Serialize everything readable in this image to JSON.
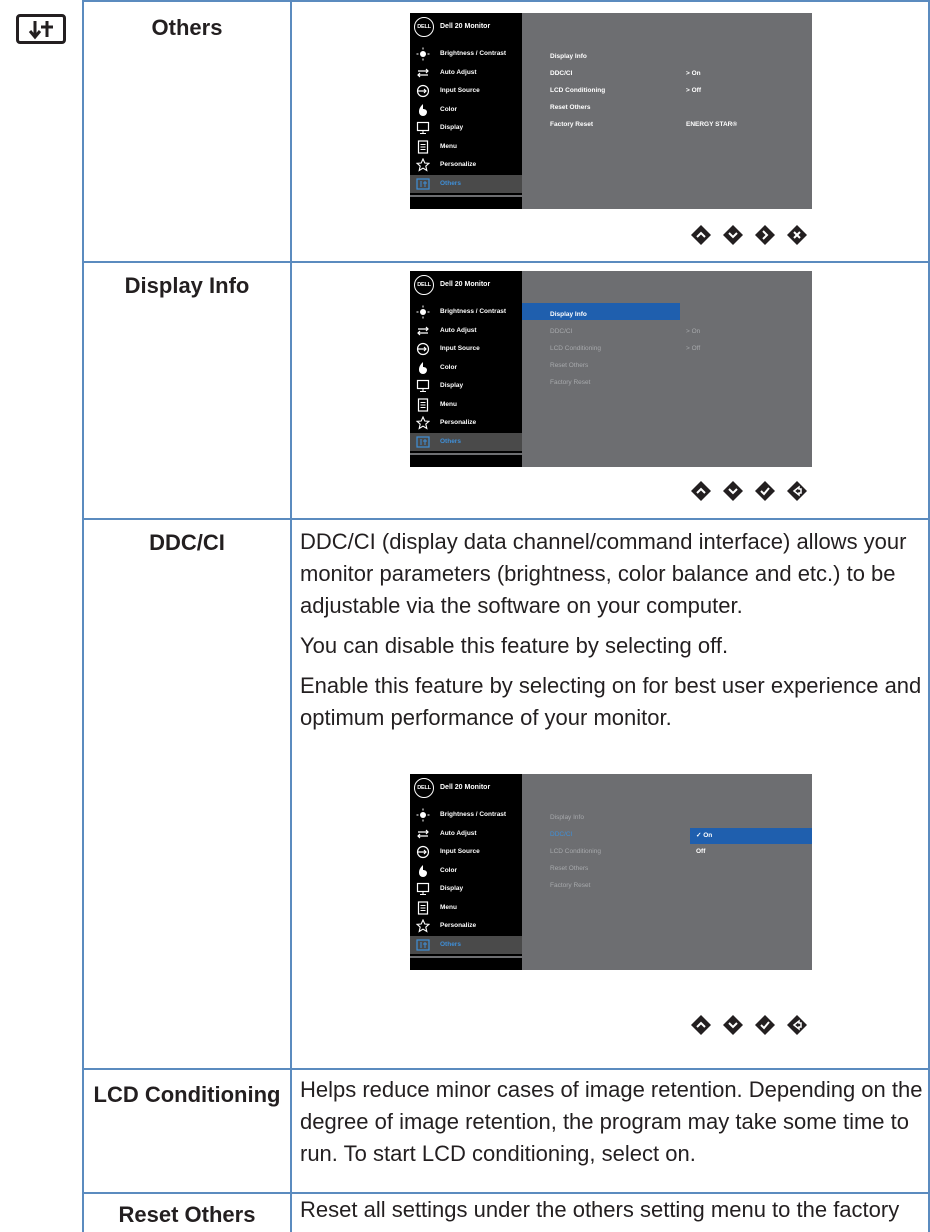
{
  "rows": [
    {
      "label": "Others",
      "osd": {
        "title": "Dell 20 Monitor",
        "logo": "DELL",
        "menu": [
          "Brightness / Contrast",
          "Auto Adjust",
          "Input Source",
          "Color",
          "Display",
          "Menu",
          "Personalize",
          "Others"
        ],
        "options": [
          "Display Info",
          "DDC/CI",
          "LCD Conditioning",
          "Reset Others",
          "Factory Reset"
        ],
        "values": [
          "On",
          "Off"
        ],
        "extra": "ENERGY STAR®"
      }
    },
    {
      "label": "Display Info",
      "osd": {
        "title": "Dell 20 Monitor",
        "logo": "DELL",
        "menu": [
          "Brightness / Contrast",
          "Auto Adjust",
          "Input Source",
          "Color",
          "Display",
          "Menu",
          "Personalize",
          "Others"
        ],
        "options": [
          "Display Info",
          "DDC/CI",
          "LCD Conditioning",
          "Reset Others",
          "Factory Reset"
        ],
        "values": [
          "On",
          "Off"
        ]
      }
    },
    {
      "label": "DDC/CI",
      "paragraphs": [
        "DDC/CI (display data channel/command interface) allows your monitor parameters (brightness, color balance and etc.) to be adjustable via the software on your computer.",
        "You can disable this feature by selecting off.",
        "Enable this feature by selecting on for best user experience and optimum performance of your monitor."
      ],
      "osd": {
        "title": "Dell 20 Monitor",
        "logo": "DELL",
        "menu": [
          "Brightness / Contrast",
          "Auto Adjust",
          "Input Source",
          "Color",
          "Display",
          "Menu",
          "Personalize",
          "Others"
        ],
        "options": [
          "Display Info",
          "DDC/CI",
          "LCD Conditioning",
          "Reset Others",
          "Factory Reset"
        ],
        "values": [
          "On",
          "Off"
        ]
      }
    },
    {
      "label": "LCD Conditioning",
      "paragraphs": [
        "Helps reduce minor cases of image retention. Depending on the degree of image retention, the program may take some time to run. To start LCD conditioning, select on."
      ]
    },
    {
      "label": "Reset Others",
      "paragraphs": [
        "Reset all settings under the others setting menu to the factory preset values."
      ]
    }
  ],
  "colors": {
    "grid": "#5b8bbf",
    "osd_bg": "#6d6e71",
    "highlight": "#1f5fae",
    "active_text": "#3f8fd8"
  }
}
